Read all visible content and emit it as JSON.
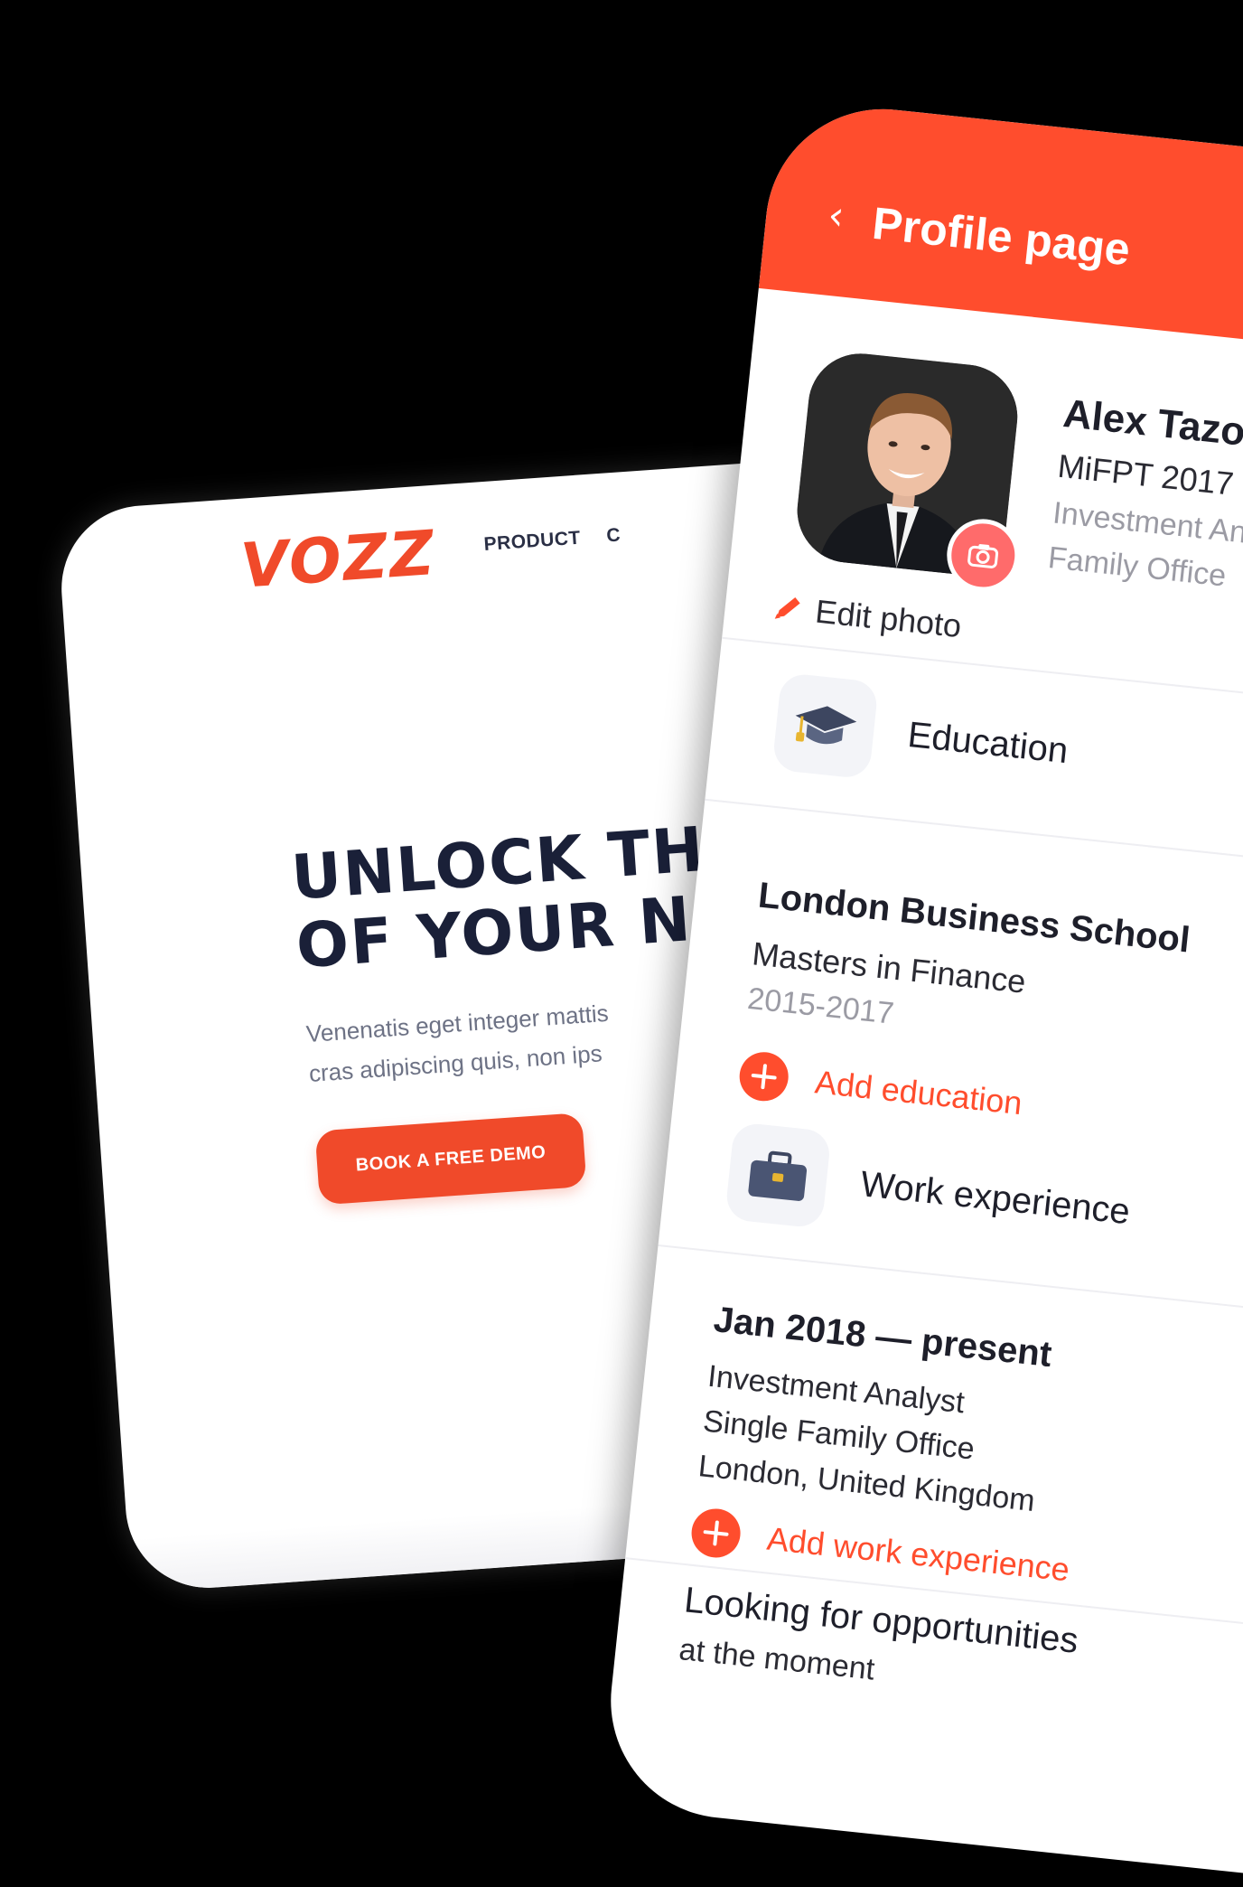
{
  "website": {
    "logo": "VOZZ",
    "nav": [
      "PRODUCT",
      "C"
    ],
    "hero_title_line1": "UNLOCK THE",
    "hero_title_line2": "OF YOUR NE",
    "hero_text_line1": "Venenatis eget integer mattis",
    "hero_text_line2": "cras adipiscing quis, non ips",
    "cta_label": "BOOK A FREE DEMO"
  },
  "profile": {
    "back_icon": "chevron-left-icon",
    "header_title": "Profile page",
    "edit_photo_label": "Edit photo",
    "name": "Alex Tazov",
    "degree": "MiFPT 2017",
    "role": "Investment Analys",
    "organization": "Family Office",
    "education": {
      "title": "Education",
      "school": "London Business School",
      "program": "Masters in Finance",
      "years": "2015-2017",
      "add_label": "Add education"
    },
    "work": {
      "title": "Work experience",
      "period": "Jan 2018 — present",
      "position": "Investment Analyst",
      "company": "Single Family Office",
      "location": "London, United Kingdom",
      "add_label": "Add work experience"
    },
    "looking_title": "Looking for opportunities",
    "looking_sub": "at the moment"
  },
  "colors": {
    "accent": "#ff4d2d",
    "navy": "#1a2038",
    "muted": "#9b9ba4"
  }
}
